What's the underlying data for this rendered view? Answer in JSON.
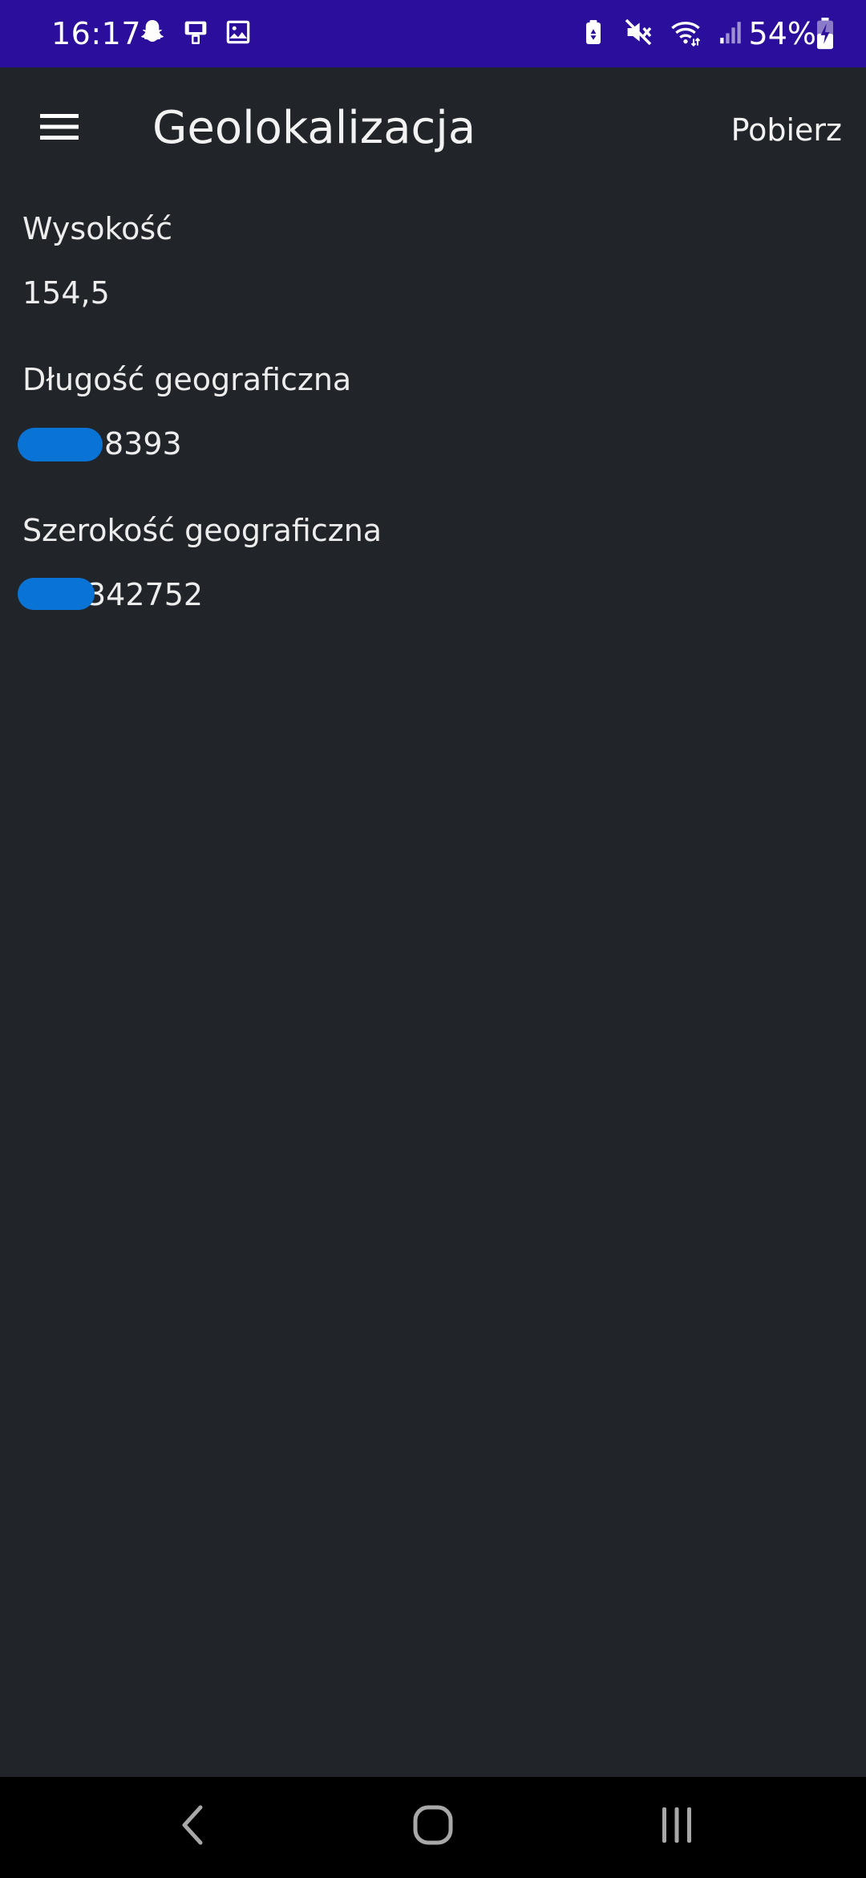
{
  "status_bar": {
    "time": "16:17",
    "battery": "54%",
    "left_icons": [
      "snapchat-icon",
      "cast-icon",
      "image-icon"
    ],
    "right_icons": [
      "battery-saver-icon",
      "mute-icon",
      "wifi-icon",
      "signal-icon"
    ],
    "background": "#2B0E9B"
  },
  "app_bar": {
    "title": "Geolokalizacja",
    "action": "Pobierz",
    "menu_icon": "hamburger-menu-icon"
  },
  "fields": [
    {
      "label": "Wysokość",
      "value": "154,5"
    },
    {
      "label": "Długość geograficzna",
      "value": "8393"
    },
    {
      "label": "Szerokość geograficzna",
      "value": "342752"
    }
  ],
  "nav_bar": {
    "icons": [
      "back-icon",
      "home-icon",
      "recents-icon"
    ]
  },
  "colors": {
    "background": "#212429",
    "redaction": "#0A74D6",
    "text": "#EDEDED"
  }
}
